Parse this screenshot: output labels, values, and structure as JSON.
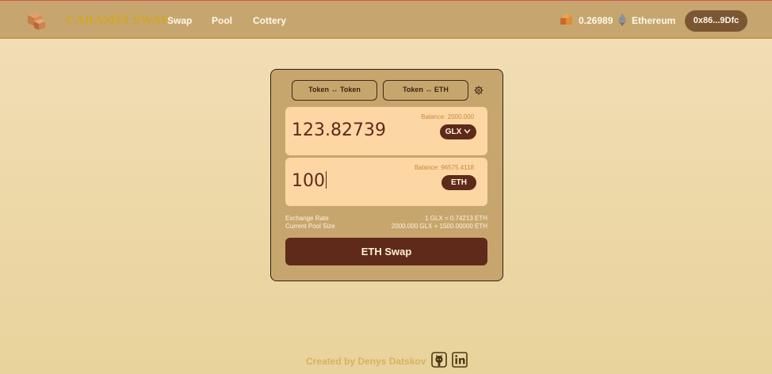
{
  "header": {
    "brand": "CARAMELSWAP",
    "nav": [
      "Swap",
      "Pool",
      "Cottery"
    ],
    "token_balance": "0.26989",
    "network": "Ethereum",
    "wallet": "0x86...9Dfc"
  },
  "swap": {
    "modes": [
      "Token ↔ Token",
      "Token ↔ ETH"
    ],
    "from": {
      "balance": "Balance: 2000.000",
      "amount": "123.82739",
      "token": "GLX"
    },
    "to": {
      "balance": "Balance: 96575.4118",
      "amount": "100",
      "token": "ETH"
    },
    "info": [
      {
        "label": "Exchange Rate",
        "value": "1 GLX = 0.74213 ETH"
      },
      {
        "label": "Current Pool Size",
        "value": "2000.000 GLX + 1500.00000 ETH"
      }
    ],
    "action": "ETH Swap"
  },
  "footer": {
    "credit": "Created by Denys Datskov",
    "icons": [
      "github-icon",
      "linkedin-icon"
    ]
  },
  "colors": {
    "header_bg": "#c6a66e",
    "brand": "#d4a52a",
    "card_bg": "#c7a66e",
    "field_bg": "#fcd7a4",
    "primary_dark": "#5f2a1a",
    "wallet_bg": "#7a5633"
  }
}
